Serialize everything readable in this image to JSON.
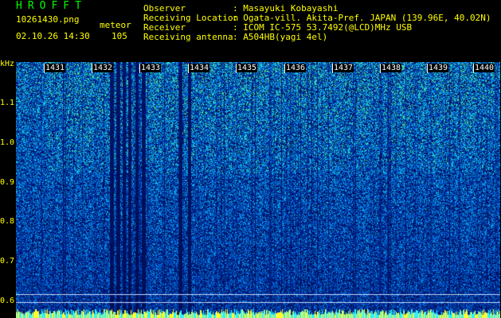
{
  "header": {
    "app_title": "HROFFT",
    "file_name": "10261430.png",
    "datetime": "02.10.26 14:30",
    "mode_label": "meteor",
    "count": "105",
    "info": [
      {
        "label": "Observer",
        "value": ": Masayuki Kobayashi"
      },
      {
        "label": "Receiving Location",
        "value": ": Ogata-vill. Akita-Pref. JAPAN (139.96E, 40.02N)"
      },
      {
        "label": "Receiver",
        "value": ": ICOM IC-575 53.7492(@LCD)MHz USB"
      },
      {
        "label": "Receiving antenna",
        "value": ": A504HB(yagi 4el)"
      }
    ]
  },
  "y_axis": {
    "unit": "kHz",
    "ticks": [
      "1.1",
      "1.0",
      "0.9",
      "0.8",
      "0.7",
      "0.6"
    ]
  },
  "time_axis": {
    "labels": [
      "1431",
      "1432",
      "1433",
      "1434",
      "1435",
      "1436",
      "1437",
      "1438",
      "1439",
      "1440"
    ]
  },
  "colors": {
    "header_text": "#ffff00",
    "title": "#00ff00",
    "spectrogram_low": "#000a5a",
    "spectrogram_mid": "#0a50ff",
    "spectrogram_high": "#30e0a0"
  }
}
